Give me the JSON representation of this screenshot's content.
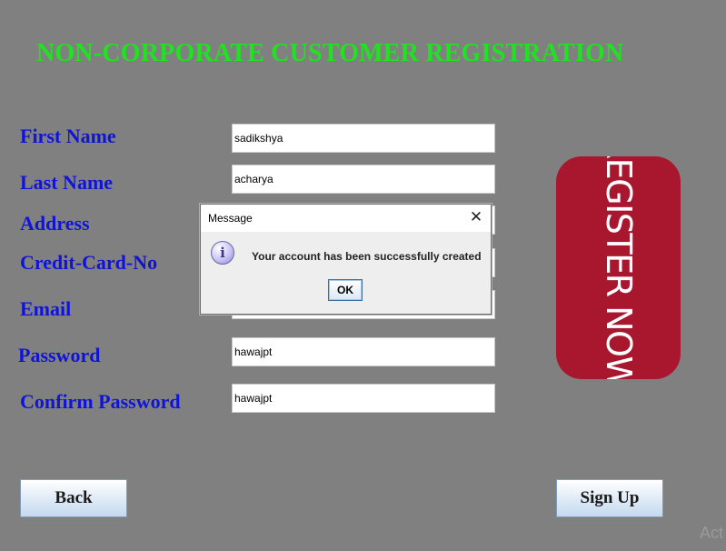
{
  "title": "NON-CORPORATE CUSTOMER REGISTRATION",
  "form": {
    "first_name_label": "First Name",
    "first_name_value": "sadikshya",
    "last_name_label": "Last Name",
    "last_name_value": "acharya",
    "address_label": "Address",
    "address_value": "",
    "credit_card_label": "Credit-Card-No",
    "credit_card_value": "",
    "email_label": "Email",
    "email_value": "",
    "password_label": "Password",
    "password_value": "hawajpt",
    "confirm_password_label": "Confirm Password",
    "confirm_password_value": "hawajpt"
  },
  "banner": {
    "text": "REGISTER NOW!",
    "color": "#a9172f"
  },
  "buttons": {
    "back": "Back",
    "signup": "Sign Up"
  },
  "dialog": {
    "title": "Message",
    "close_glyph": "✕",
    "icon": "info-icon",
    "icon_glyph": "i",
    "message": "Your account has been successfully created",
    "ok": "OK"
  },
  "watermark": "Act",
  "colors": {
    "background": "#808080",
    "title": "#22e022",
    "labels": "#0f14d6"
  }
}
